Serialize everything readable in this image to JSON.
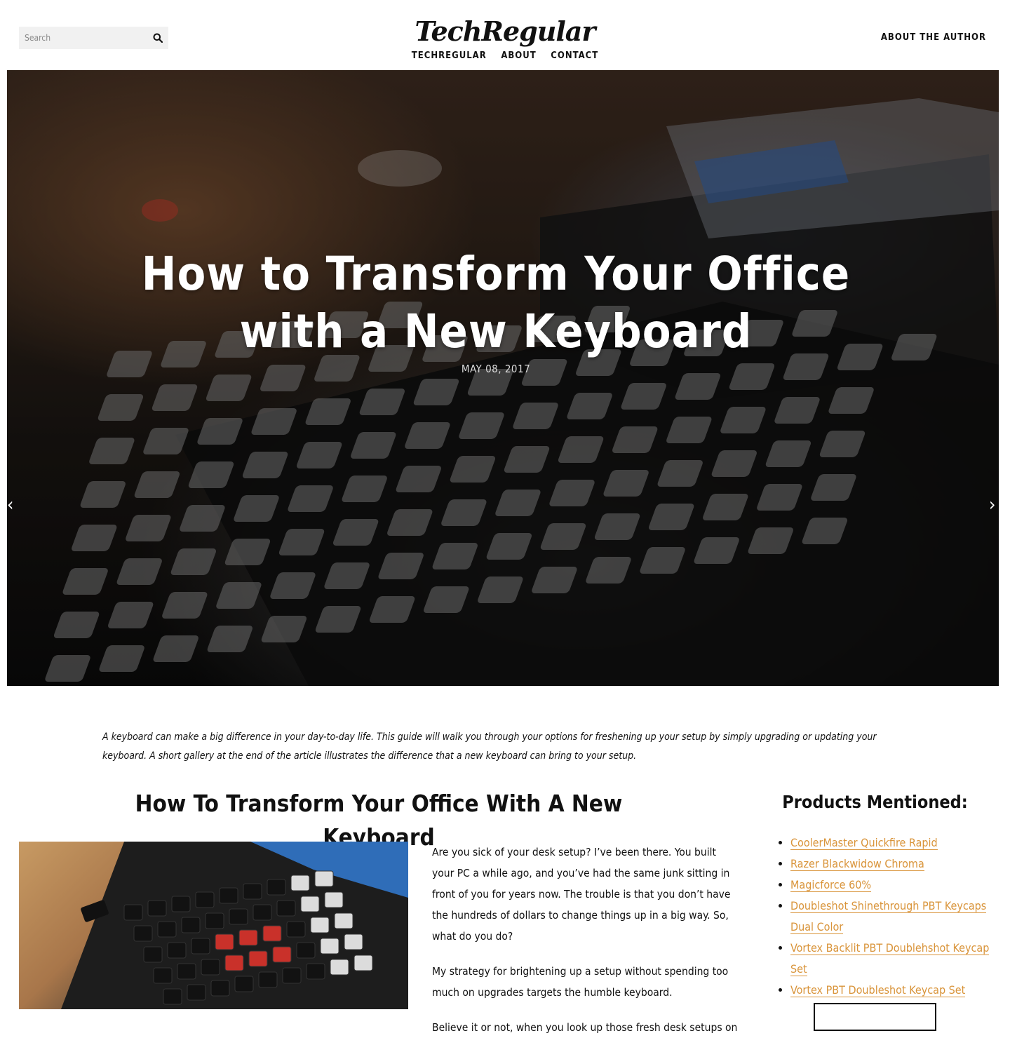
{
  "header": {
    "search_placeholder": "Search",
    "logo": "TechRegular",
    "nav": [
      "TECHREGULAR",
      "ABOUT",
      "CONTACT"
    ],
    "author_link": "ABOUT THE AUTHOR"
  },
  "hero": {
    "title": "How to Transform Your Office with a New Keyboard",
    "date": "MAY 08, 2017",
    "prev": "‹",
    "next": "›"
  },
  "intro": "A keyboard can make a big difference in your day-to-day life. This guide will walk you through your options for freshening up your setup by simply upgrading or updating your keyboard. A short gallery at the end of the article illustrates the difference that a new keyboard can bring to your setup.",
  "article": {
    "title": "How To Transform Your Office With A New Keyboard",
    "paragraphs": [
      "Are you sick of your desk setup? I’ve been there. You built your PC a while ago, and you’ve had the same junk sitting in front of you for years now. The trouble is that you don’t have the hundreds of dollars to change things up in a big way. So, what do you do?",
      "My strategy for brightening up a setup without spending too much on upgrades targets the humble keyboard.",
      "Believe it or not, when you look up those fresh desk setups on"
    ]
  },
  "sidebar": {
    "title": "Products Mentioned:",
    "products": [
      "CoolerMaster Quickfire Rapid",
      "Razer Blackwidow Chroma",
      "Magicforce 60%",
      "Doubleshot Shinethrough PBT Keycaps Dual Color",
      "Vortex Backlit PBT Doublehshot Keycap Set",
      "Vortex PBT Doubleshot Keycap Set"
    ]
  },
  "colors": {
    "accent_link": "#d9943a",
    "text": "#111111",
    "search_bg": "#f1f1f1"
  },
  "icons": [
    "search-icon",
    "chevron-left-icon",
    "chevron-right-icon"
  ]
}
